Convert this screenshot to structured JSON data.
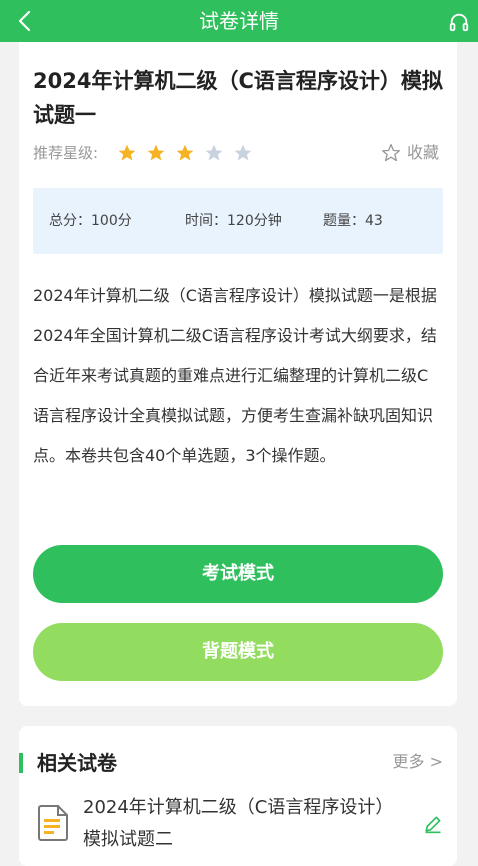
{
  "header": {
    "title": "试卷详情",
    "back_icon": "chevron-left-icon",
    "right_icon": "headset-icon",
    "bg_color": "#2fbf5d"
  },
  "exam": {
    "title": "2024年计算机二级（C语言程序设计）模拟试题一",
    "rating_label": "推荐星级:",
    "rating": 3,
    "rating_max": 5,
    "favorite_label": "收藏",
    "total_score": "总分：100分",
    "time": "时间：120分钟",
    "question_count": "题量：43",
    "description": "2024年计算机二级（C语言程序设计）模拟试题一是根据2024年全国计算机二级C语言程序设计考试大纲要求，结合近年来考试真题的重难点进行汇编整理的计算机二级C语言程序设计全真模拟试题，方便考生查漏补缺巩固知识点。本卷共包含40个单选题，3个操作题。",
    "exam_mode_label": "考试模式",
    "study_mode_label": "背题模式"
  },
  "related": {
    "title": "相关试卷",
    "more_label": "更多 >",
    "items": [
      {
        "title": "2024年计算机二级（C语言程序设计）模拟试题二"
      }
    ]
  },
  "colors": {
    "primary": "#2fbf5d",
    "secondary": "#92dd5f",
    "star_active": "#f5b324",
    "star_inactive": "#c9d3e0",
    "info_bg": "#e8f3fd"
  }
}
